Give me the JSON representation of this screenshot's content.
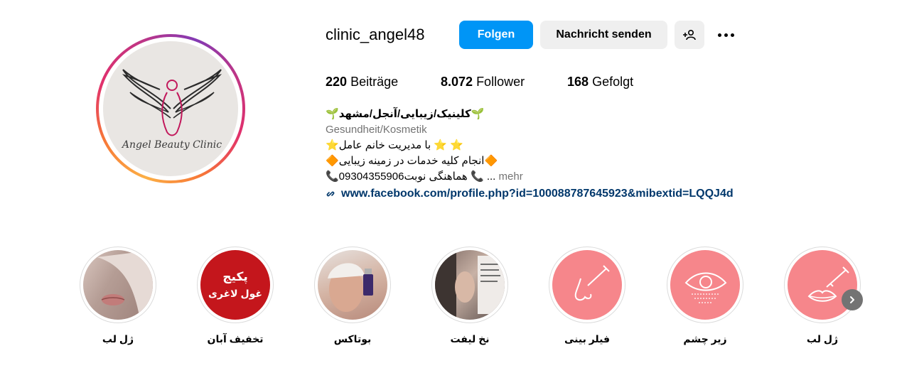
{
  "profile": {
    "username": "clinic_angel48",
    "avatar_text": "Angel Beauty Clinic",
    "follow_label": "Folgen",
    "message_label": "Nachricht senden",
    "add_user_icon": "add-user-icon",
    "more_icon": "more-dots-icon"
  },
  "stats": {
    "posts_count": "220",
    "posts_label": "Beiträge",
    "followers_count": "8.072",
    "followers_label": "Follower",
    "following_count": "168",
    "following_label": "Gefolgt"
  },
  "bio": {
    "name": "🌱کلینیک/زیبایی/آنجل/مشهد🌱",
    "category": "Gesundheit/Kosmetik",
    "line1": "⭐با مدیریت خانم عامل ⭐ ⭐",
    "line2": "🔶انجام کلیه خدمات در زمینه زیبایی🔶",
    "line3": "📞09304355906هماهنگی نوبت 📞 ...",
    "more_label": "mehr",
    "link": "www.facebook.com/profile.php?id=100088787645923&mibextid=LQQJ4d"
  },
  "highlights": [
    {
      "label": "ژل لب",
      "icon": "lip-filler-icon",
      "color": "#f6868b"
    },
    {
      "label": "زیر چشم",
      "icon": "eye-icon",
      "color": "#f6868b"
    },
    {
      "label": "فیلر بینی",
      "icon": "nose-syringe-icon",
      "color": "#f6868b"
    },
    {
      "label": "نخ لیفت",
      "icon": "photo-thumbnail",
      "color": "#6b5a55"
    },
    {
      "label": "بوتاکس",
      "icon": "photo-thumbnail",
      "color": "#c9a89a"
    },
    {
      "label": "تخفیف آبان",
      "icon": "text-thumbnail",
      "color": "#c4161c",
      "thumb_line1": "پکیج",
      "thumb_line2": "غول لاغری"
    },
    {
      "label": "ژل لب",
      "icon": "photo-thumbnail",
      "color": "#b9a39b"
    }
  ],
  "colors": {
    "primary_button": "#0095f6",
    "secondary_button": "#efefef",
    "link": "#00376b",
    "muted": "#737373"
  }
}
